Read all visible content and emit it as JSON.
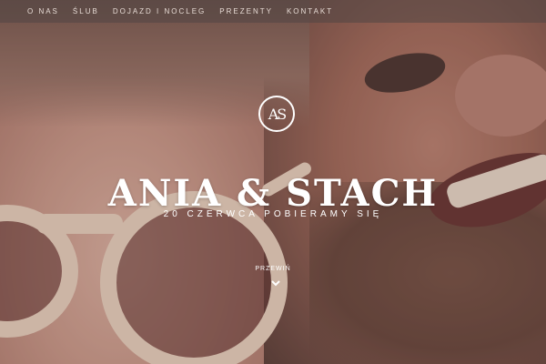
{
  "nav": {
    "items": [
      {
        "label": "O NAS"
      },
      {
        "label": "ŚLUB"
      },
      {
        "label": "DOJAZD I NOCLEG"
      },
      {
        "label": "PREZENTY"
      },
      {
        "label": "KONTAKT"
      }
    ]
  },
  "logo": {
    "monogram": "AS"
  },
  "hero": {
    "title": "ANIA & STACH",
    "subtitle": "20 CZERWCA POBIERAMY SIĘ",
    "scroll_label": "PRZEWIŃ",
    "scroll_icon": "chevron-down-icon"
  },
  "colors": {
    "text": "#ffffff",
    "nav_background": "#50464480"
  }
}
